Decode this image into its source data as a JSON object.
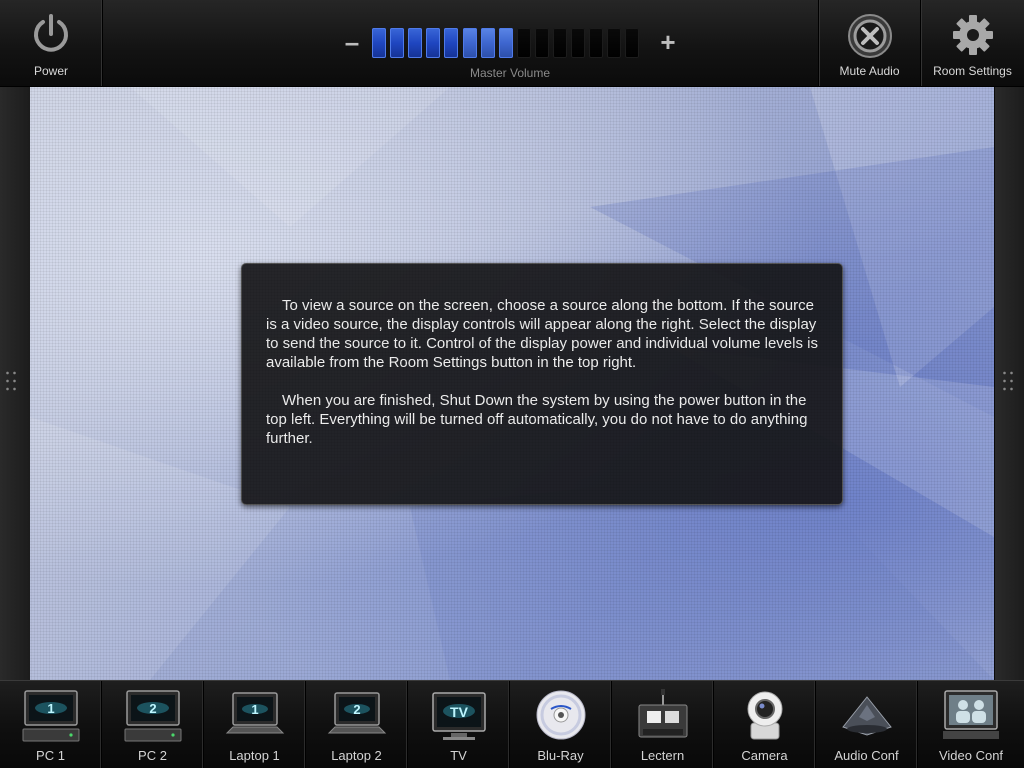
{
  "top": {
    "power_label": "Power",
    "mute_label": "Mute Audio",
    "settings_label": "Room Settings"
  },
  "volume": {
    "minus_label": "–",
    "plus_label": "+",
    "label": "Master Volume",
    "level": 8,
    "segments": 15
  },
  "instructions": {
    "paragraph_1": "To view a source on the screen, choose a source along the bottom.  If the source is a video source, the display controls will appear along the right. Select the display to send the source to it.  Control of the display power and individual volume levels is available from the Room Settings button in the top right.",
    "paragraph_2": "When you are finished, Shut Down the system by using the power button in the top left.  Everything will be turned off automatically, you do not have to do anything further."
  },
  "sources": [
    {
      "label": "PC 1",
      "icon": "pc-monitor-icon",
      "badge": "1"
    },
    {
      "label": "PC 2",
      "icon": "pc-monitor-icon",
      "badge": "2"
    },
    {
      "label": "Laptop 1",
      "icon": "laptop-icon",
      "badge": "1"
    },
    {
      "label": "Laptop 2",
      "icon": "laptop-icon",
      "badge": "2"
    },
    {
      "label": "TV",
      "icon": "tv-icon",
      "badge": "TV"
    },
    {
      "label": "Blu-Ray",
      "icon": "bluray-disc-icon"
    },
    {
      "label": "Lectern",
      "icon": "lectern-icon"
    },
    {
      "label": "Camera",
      "icon": "camera-icon"
    },
    {
      "label": "Audio Conf",
      "icon": "conference-phone-icon"
    },
    {
      "label": "Video Conf",
      "icon": "video-conference-icon"
    }
  ],
  "colors": {
    "volume_on": "#2a52c8",
    "badge_cyan": "#4ad6f0"
  }
}
